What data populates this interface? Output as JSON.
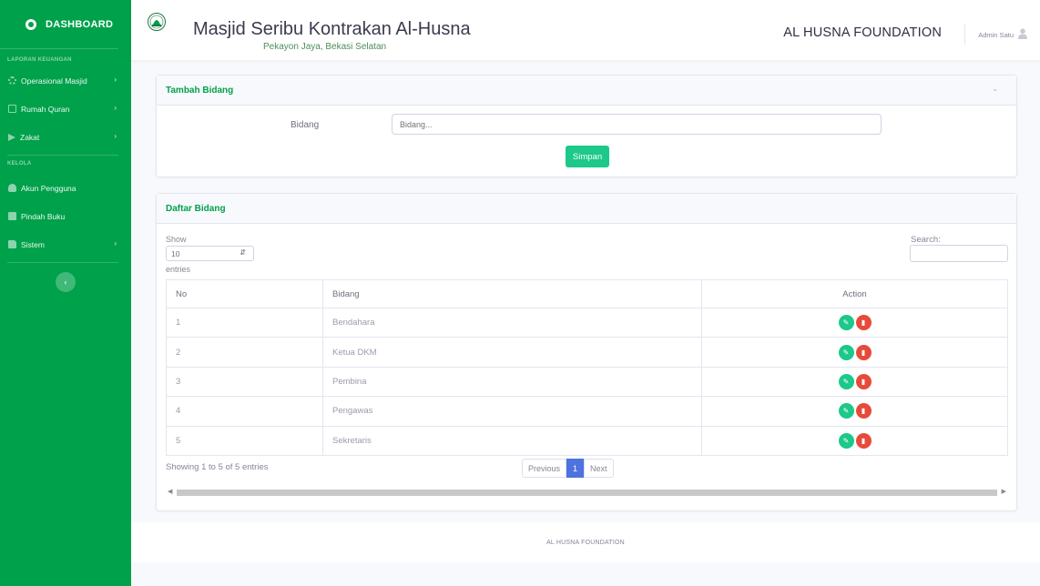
{
  "sidebar": {
    "brand": "DASHBOARD",
    "heading_laporan": "LAPORAN KEUANGAN",
    "heading_kelola": "KELOLA",
    "items": [
      {
        "label": "Operasional Masjid",
        "icon": "gear-icon",
        "has_children": true
      },
      {
        "label": "Rumah Quran",
        "icon": "book-icon",
        "has_children": true
      },
      {
        "label": "Zakat",
        "icon": "paper-plane-icon",
        "has_children": true
      },
      {
        "label": "Akun Pengguna",
        "icon": "users-icon",
        "has_children": false
      },
      {
        "label": "Pindah Buku",
        "icon": "document-icon",
        "has_children": false
      },
      {
        "label": "Sistem",
        "icon": "folder-icon",
        "has_children": true
      }
    ],
    "chevron": "›",
    "toggle": "‹"
  },
  "header": {
    "title": "Masjid Seribu Kontrakan Al-Husna",
    "subtitle": "Pekayon Jaya, Bekasi Selatan",
    "org_name": "AL HUSNA FOUNDATION",
    "user_name": "Admin Satu"
  },
  "tambah_card": {
    "title": "Tambah Bidang",
    "field_label": "Bidang",
    "field_placeholder": "Bidang...",
    "field_value": "",
    "submit_label": "Simpan"
  },
  "daftar_card": {
    "title": "Daftar Bidang",
    "show_label": "Show",
    "page_size": "10",
    "entries_label": "entries",
    "search_label": "Search:",
    "search_value": "",
    "columns": [
      "No",
      "Bidang",
      "Action"
    ],
    "rows": [
      {
        "no": "1",
        "bidang": "Bendahara"
      },
      {
        "no": "2",
        "bidang": "Ketua DKM"
      },
      {
        "no": "3",
        "bidang": "Pembina"
      },
      {
        "no": "4",
        "bidang": "Pengawas"
      },
      {
        "no": "5",
        "bidang": "Sekretaris"
      }
    ],
    "info": "Showing 1 to 5 of 5 entries",
    "pagination": {
      "previous": "Previous",
      "current": "1",
      "next": "Next"
    }
  },
  "footer": {
    "text": "AL HUSNA FOUNDATION"
  },
  "colors": {
    "primary": "#00a14b",
    "success": "#1cc88a",
    "danger": "#e74a3b",
    "page_active": "#4e73df"
  }
}
